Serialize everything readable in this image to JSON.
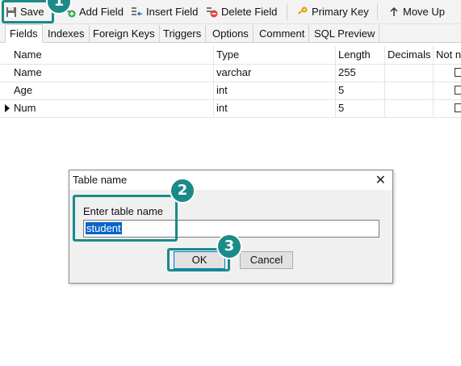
{
  "toolbar": {
    "save": "Save",
    "add_field": "Add Field",
    "insert_field": "Insert Field",
    "delete_field": "Delete Field",
    "primary_key": "Primary Key",
    "move_up": "Move Up"
  },
  "tabs": [
    "Fields",
    "Indexes",
    "Foreign Keys",
    "Triggers",
    "Options",
    "Comment",
    "SQL Preview"
  ],
  "grid": {
    "columns": [
      "Name",
      "Type",
      "Length",
      "Decimals",
      "Not n"
    ],
    "rows": [
      {
        "name": "Name",
        "type": "varchar",
        "length": "255"
      },
      {
        "name": "Age",
        "type": "int",
        "length": "5"
      },
      {
        "name": "Num",
        "type": "int",
        "length": "5"
      }
    ]
  },
  "dialog": {
    "title": "Table name",
    "label": "Enter table name",
    "value": "student",
    "ok": "OK",
    "cancel": "Cancel",
    "close": "✕"
  },
  "annotations": [
    "1",
    "2",
    "3"
  ],
  "colors": {
    "annotation": "#1a8b88",
    "selection": "#0a64c8"
  }
}
